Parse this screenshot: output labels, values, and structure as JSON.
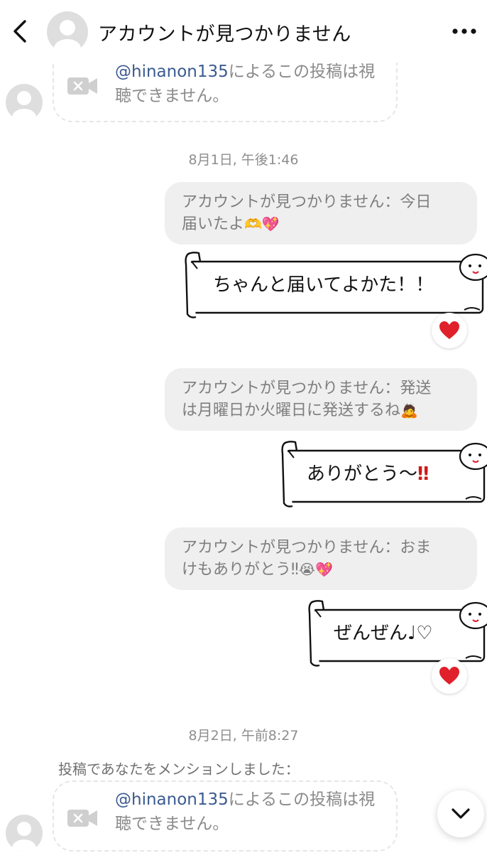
{
  "header": {
    "title": "アカウントが見つかりません",
    "back_icon": "chevron-left-icon",
    "more_icon": "more-horizontal-icon"
  },
  "messages": {
    "shared_post_1": {
      "mention": "@hinanon135",
      "line1_rest": "によるこの投稿は視",
      "line2": "聴できません。"
    },
    "timestamp_1": "8月1日, 午後1:46",
    "reply_1": {
      "line1": "アカウントが見つかりません：今日",
      "line2": "届いたよ",
      "emoji": "🫶💖"
    },
    "sticker_1": {
      "text": "ちゃんと届いてよかた！！"
    },
    "reaction_1": "❤",
    "reply_2": {
      "line1": "アカウントが見つかりません：発送",
      "line2": "は月曜日か火曜日に発送するね",
      "emoji": "🙇"
    },
    "sticker_2": {
      "text": "ありがとう〜",
      "accent": "‼"
    },
    "reply_3": {
      "line1": "アカウントが見つかりません：おま",
      "line2": "けもありがとう‼",
      "emoji": "😭💖"
    },
    "sticker_3": {
      "text": "ぜんぜん♩♡"
    },
    "reaction_2": "❤",
    "timestamp_2": "8月2日, 午前8:27",
    "mention_note": "投稿であなたをメンションしました：",
    "shared_post_2": {
      "mention": "@hinanon135",
      "line1_rest": "によるこの投稿は視",
      "line2": "聴できません。"
    }
  },
  "colors": {
    "mention": "#3a5a8f",
    "reply_bubble": "#efefef",
    "reaction_heart": "#e0202a",
    "accent_red": "#d01818"
  }
}
